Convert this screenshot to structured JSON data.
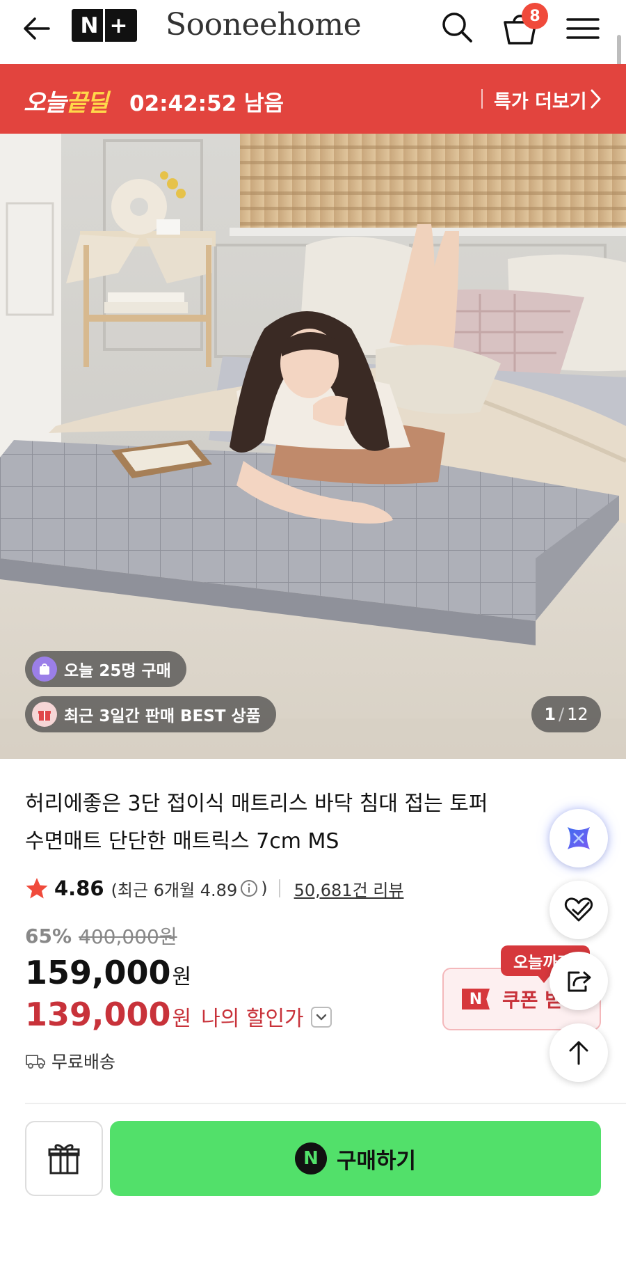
{
  "header": {
    "back_icon": "arrow-left-icon",
    "nplus_logo": "N+",
    "brand": "Sooneehome",
    "search_icon": "search-icon",
    "cart_icon": "shopping-bag-icon",
    "cart_count": "8",
    "menu_icon": "hamburger-menu-icon"
  },
  "deal": {
    "logo_part1": "오늘",
    "logo_part2": "끝딜",
    "countdown": "02:42:52 남음",
    "more_label": "특가 더보기",
    "color": "#e2443e"
  },
  "hero": {
    "badge_buyers": "오늘 25명 구매",
    "badge_best": "최근 3일간 판매 BEST 상품",
    "counter_current": "1",
    "counter_total": "12"
  },
  "product": {
    "title_line1": "허리에좋은 3단 접이식 매트리스 바닥 침대 접는 토퍼",
    "title_line2": "수면매트 단단한 매트릭스 7cm MS",
    "rating": "4.86",
    "rating_recent": "(최근 6개월 4.89",
    "rating_close": ")",
    "reviews": "50,681건 리뷰",
    "discount_pct": "65%",
    "original_price": "400,000원",
    "price": "159,000",
    "price_unit": "원",
    "my_price": "139,000",
    "my_price_unit": "원",
    "my_price_label": "나의 할인가",
    "shipping": "무료배송"
  },
  "coupon": {
    "tag": "오늘까지",
    "label": "쿠폰 받기",
    "logo": "N"
  },
  "actions": {
    "buy_label": "구매하기",
    "buy_logo": "N",
    "buy_color": "#52e06a"
  }
}
